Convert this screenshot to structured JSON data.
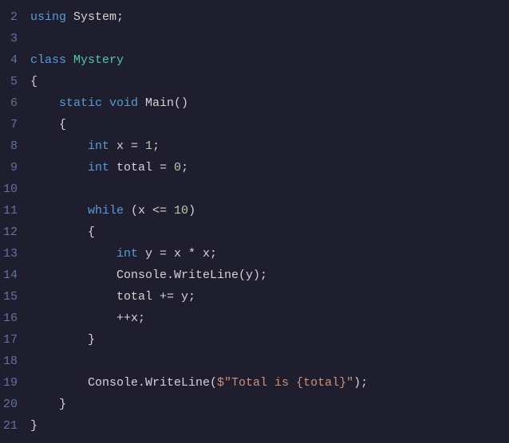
{
  "editor": {
    "background": "#1e1e2e",
    "lines": [
      {
        "num": "2",
        "tokens": [
          {
            "t": "using ",
            "c": "kw-blue"
          },
          {
            "t": "System;",
            "c": "plain"
          }
        ]
      },
      {
        "num": "3",
        "tokens": []
      },
      {
        "num": "4",
        "tokens": [
          {
            "t": "class ",
            "c": "kw-blue"
          },
          {
            "t": "Mystery",
            "c": "class-name"
          }
        ]
      },
      {
        "num": "5",
        "tokens": [
          {
            "t": "{",
            "c": "plain"
          }
        ]
      },
      {
        "num": "6",
        "tokens": [
          {
            "t": "    ",
            "c": "plain"
          },
          {
            "t": "static ",
            "c": "kw-blue"
          },
          {
            "t": "void ",
            "c": "kw-blue"
          },
          {
            "t": "Main()",
            "c": "plain"
          }
        ]
      },
      {
        "num": "7",
        "tokens": [
          {
            "t": "    {",
            "c": "plain"
          }
        ]
      },
      {
        "num": "8",
        "tokens": [
          {
            "t": "        ",
            "c": "plain"
          },
          {
            "t": "int ",
            "c": "kw-blue"
          },
          {
            "t": "x = ",
            "c": "plain"
          },
          {
            "t": "1",
            "c": "num"
          },
          {
            "t": ";",
            "c": "plain"
          }
        ]
      },
      {
        "num": "9",
        "tokens": [
          {
            "t": "        ",
            "c": "plain"
          },
          {
            "t": "int ",
            "c": "kw-blue"
          },
          {
            "t": "total = ",
            "c": "plain"
          },
          {
            "t": "0",
            "c": "num"
          },
          {
            "t": ";",
            "c": "plain"
          }
        ]
      },
      {
        "num": "10",
        "tokens": []
      },
      {
        "num": "11",
        "tokens": [
          {
            "t": "        ",
            "c": "plain"
          },
          {
            "t": "while ",
            "c": "kw-blue"
          },
          {
            "t": "(x <= ",
            "c": "plain"
          },
          {
            "t": "10",
            "c": "num"
          },
          {
            "t": ")",
            "c": "plain"
          }
        ]
      },
      {
        "num": "12",
        "tokens": [
          {
            "t": "        {",
            "c": "plain"
          }
        ]
      },
      {
        "num": "13",
        "tokens": [
          {
            "t": "            ",
            "c": "plain"
          },
          {
            "t": "int ",
            "c": "kw-blue"
          },
          {
            "t": "y = x * x;",
            "c": "plain"
          }
        ]
      },
      {
        "num": "14",
        "tokens": [
          {
            "t": "            Console.WriteLine(y);",
            "c": "plain"
          }
        ]
      },
      {
        "num": "15",
        "tokens": [
          {
            "t": "            total += y;",
            "c": "plain"
          }
        ]
      },
      {
        "num": "16",
        "tokens": [
          {
            "t": "            ++x;",
            "c": "plain"
          }
        ]
      },
      {
        "num": "17",
        "tokens": [
          {
            "t": "        }",
            "c": "plain"
          }
        ]
      },
      {
        "num": "18",
        "tokens": []
      },
      {
        "num": "19",
        "tokens": [
          {
            "t": "        Console.WriteLine(",
            "c": "plain"
          },
          {
            "t": "$\"Total is {total}\"",
            "c": "str"
          },
          {
            "t": ");",
            "c": "plain"
          }
        ]
      },
      {
        "num": "20",
        "tokens": [
          {
            "t": "    }",
            "c": "plain"
          }
        ]
      },
      {
        "num": "21",
        "tokens": [
          {
            "t": "}",
            "c": "plain"
          }
        ]
      }
    ]
  }
}
